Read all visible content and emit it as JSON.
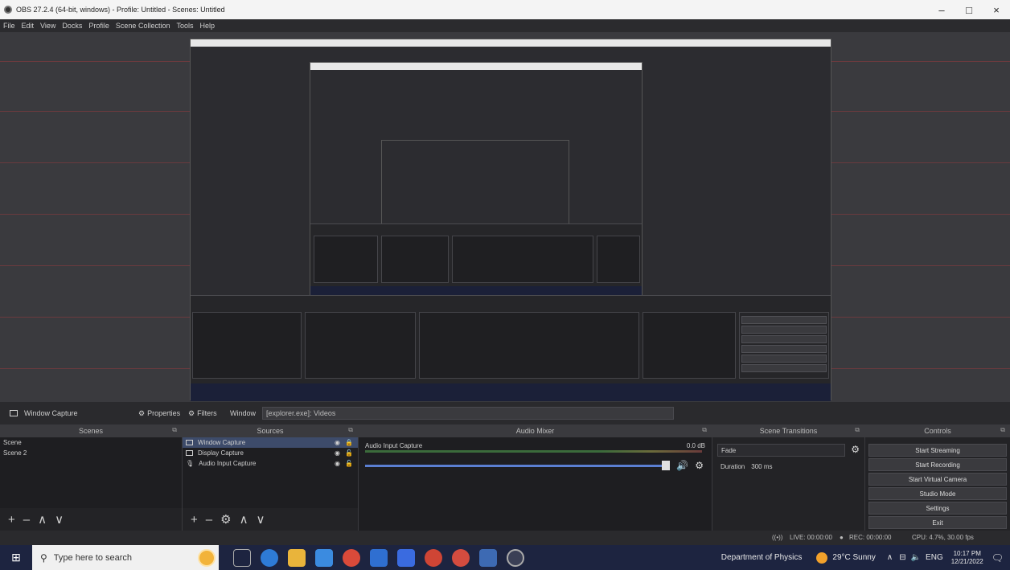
{
  "window": {
    "title": "OBS 27.2.4 (64-bit, windows) - Profile: Untitled - Scenes: Untitled",
    "minimize": "–",
    "maximize": "□",
    "close": "×"
  },
  "menu": [
    "File",
    "Edit",
    "View",
    "Docks",
    "Profile",
    "Scene Collection",
    "Tools",
    "Help"
  ],
  "source_toolbar": {
    "source_name": "Window Capture",
    "properties": "Properties",
    "filters": "Filters",
    "window_label": "Window",
    "window_value": "[explorer.exe]: Videos"
  },
  "scenes": {
    "header": "Scenes",
    "items": [
      "Scene",
      "Scene 2"
    ],
    "footer": [
      "+",
      "–",
      "∧",
      "∨"
    ]
  },
  "sources": {
    "header": "Sources",
    "items": [
      "Window Capture",
      "Display Capture",
      "Audio Input Capture"
    ],
    "footer": [
      "+",
      "–",
      "⚙",
      "∧",
      "∨"
    ]
  },
  "mixer": {
    "header": "Audio Mixer",
    "track_name": "Audio Input Capture",
    "db": "0.0 dB"
  },
  "transitions": {
    "header": "Scene Transitions",
    "transition": "Fade",
    "duration_label": "Duration",
    "duration_value": "300 ms"
  },
  "controls": {
    "header": "Controls",
    "buttons": [
      "Start Streaming",
      "Start Recording",
      "Start Virtual Camera",
      "Studio Mode",
      "Settings",
      "Exit"
    ]
  },
  "status": {
    "live": "LIVE: 00:00:00",
    "rec": "REC: 00:00:00",
    "cpu": "CPU: 4.7%, 30.00 fps"
  },
  "taskbar": {
    "search_placeholder": "Type here to search",
    "location": "Department of Physics",
    "weather": "29°C  Sunny",
    "lang": "ENG",
    "time": "10:17 PM",
    "date": "12/21/2022"
  },
  "colors": {
    "accent": "#3d4b6a",
    "taskbar": "#1d2440",
    "panel": "#232326"
  }
}
